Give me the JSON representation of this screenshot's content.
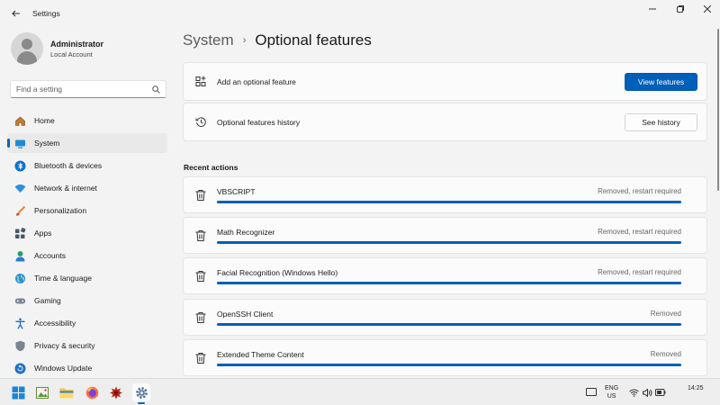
{
  "window": {
    "title": "Settings",
    "controls": {
      "minimize": "—",
      "maximize": "▢",
      "close": "✕"
    }
  },
  "profile": {
    "name": "Administrator",
    "account_type": "Local Account"
  },
  "search": {
    "placeholder": "Find a setting"
  },
  "sidebar": {
    "items": [
      {
        "label": "Home",
        "icon": "home-icon"
      },
      {
        "label": "System",
        "icon": "system-icon",
        "active": true
      },
      {
        "label": "Bluetooth & devices",
        "icon": "bluetooth-icon"
      },
      {
        "label": "Network & internet",
        "icon": "network-icon"
      },
      {
        "label": "Personalization",
        "icon": "brush-icon"
      },
      {
        "label": "Apps",
        "icon": "apps-icon"
      },
      {
        "label": "Accounts",
        "icon": "accounts-icon"
      },
      {
        "label": "Time & language",
        "icon": "globe-icon"
      },
      {
        "label": "Gaming",
        "icon": "gamepad-icon"
      },
      {
        "label": "Accessibility",
        "icon": "accessibility-icon"
      },
      {
        "label": "Privacy & security",
        "icon": "shield-icon"
      },
      {
        "label": "Windows Update",
        "icon": "update-icon"
      }
    ]
  },
  "breadcrumb": {
    "parent": "System",
    "separator": "›",
    "current": "Optional features"
  },
  "add_feature": {
    "label": "Add an optional feature",
    "button": "View features"
  },
  "history": {
    "label": "Optional features history",
    "button": "See history"
  },
  "recent": {
    "title": "Recent actions",
    "items": [
      {
        "name": "VBSCRIPT",
        "status": "Removed, restart required",
        "progress": 1.0
      },
      {
        "name": "Math Recognizer",
        "status": "Removed, restart required",
        "progress": 1.0
      },
      {
        "name": "Facial Recognition (Windows Hello)",
        "status": "Removed, restart required",
        "progress": 1.0
      },
      {
        "name": "OpenSSH Client",
        "status": "Removed",
        "progress": 1.0
      },
      {
        "name": "Extended Theme Content",
        "status": "Removed",
        "progress": 1.0
      }
    ]
  },
  "taskbar": {
    "apps": [
      "start-icon",
      "photo-app-icon",
      "file-explorer-icon",
      "firefox-icon",
      "paint-app-icon",
      "settings-icon"
    ],
    "language": {
      "line1": "ENG",
      "line2": "US"
    },
    "time": "14:25",
    "date": ""
  },
  "colors": {
    "accent": "#005fb8",
    "nav_indicator": "#0067c0"
  }
}
